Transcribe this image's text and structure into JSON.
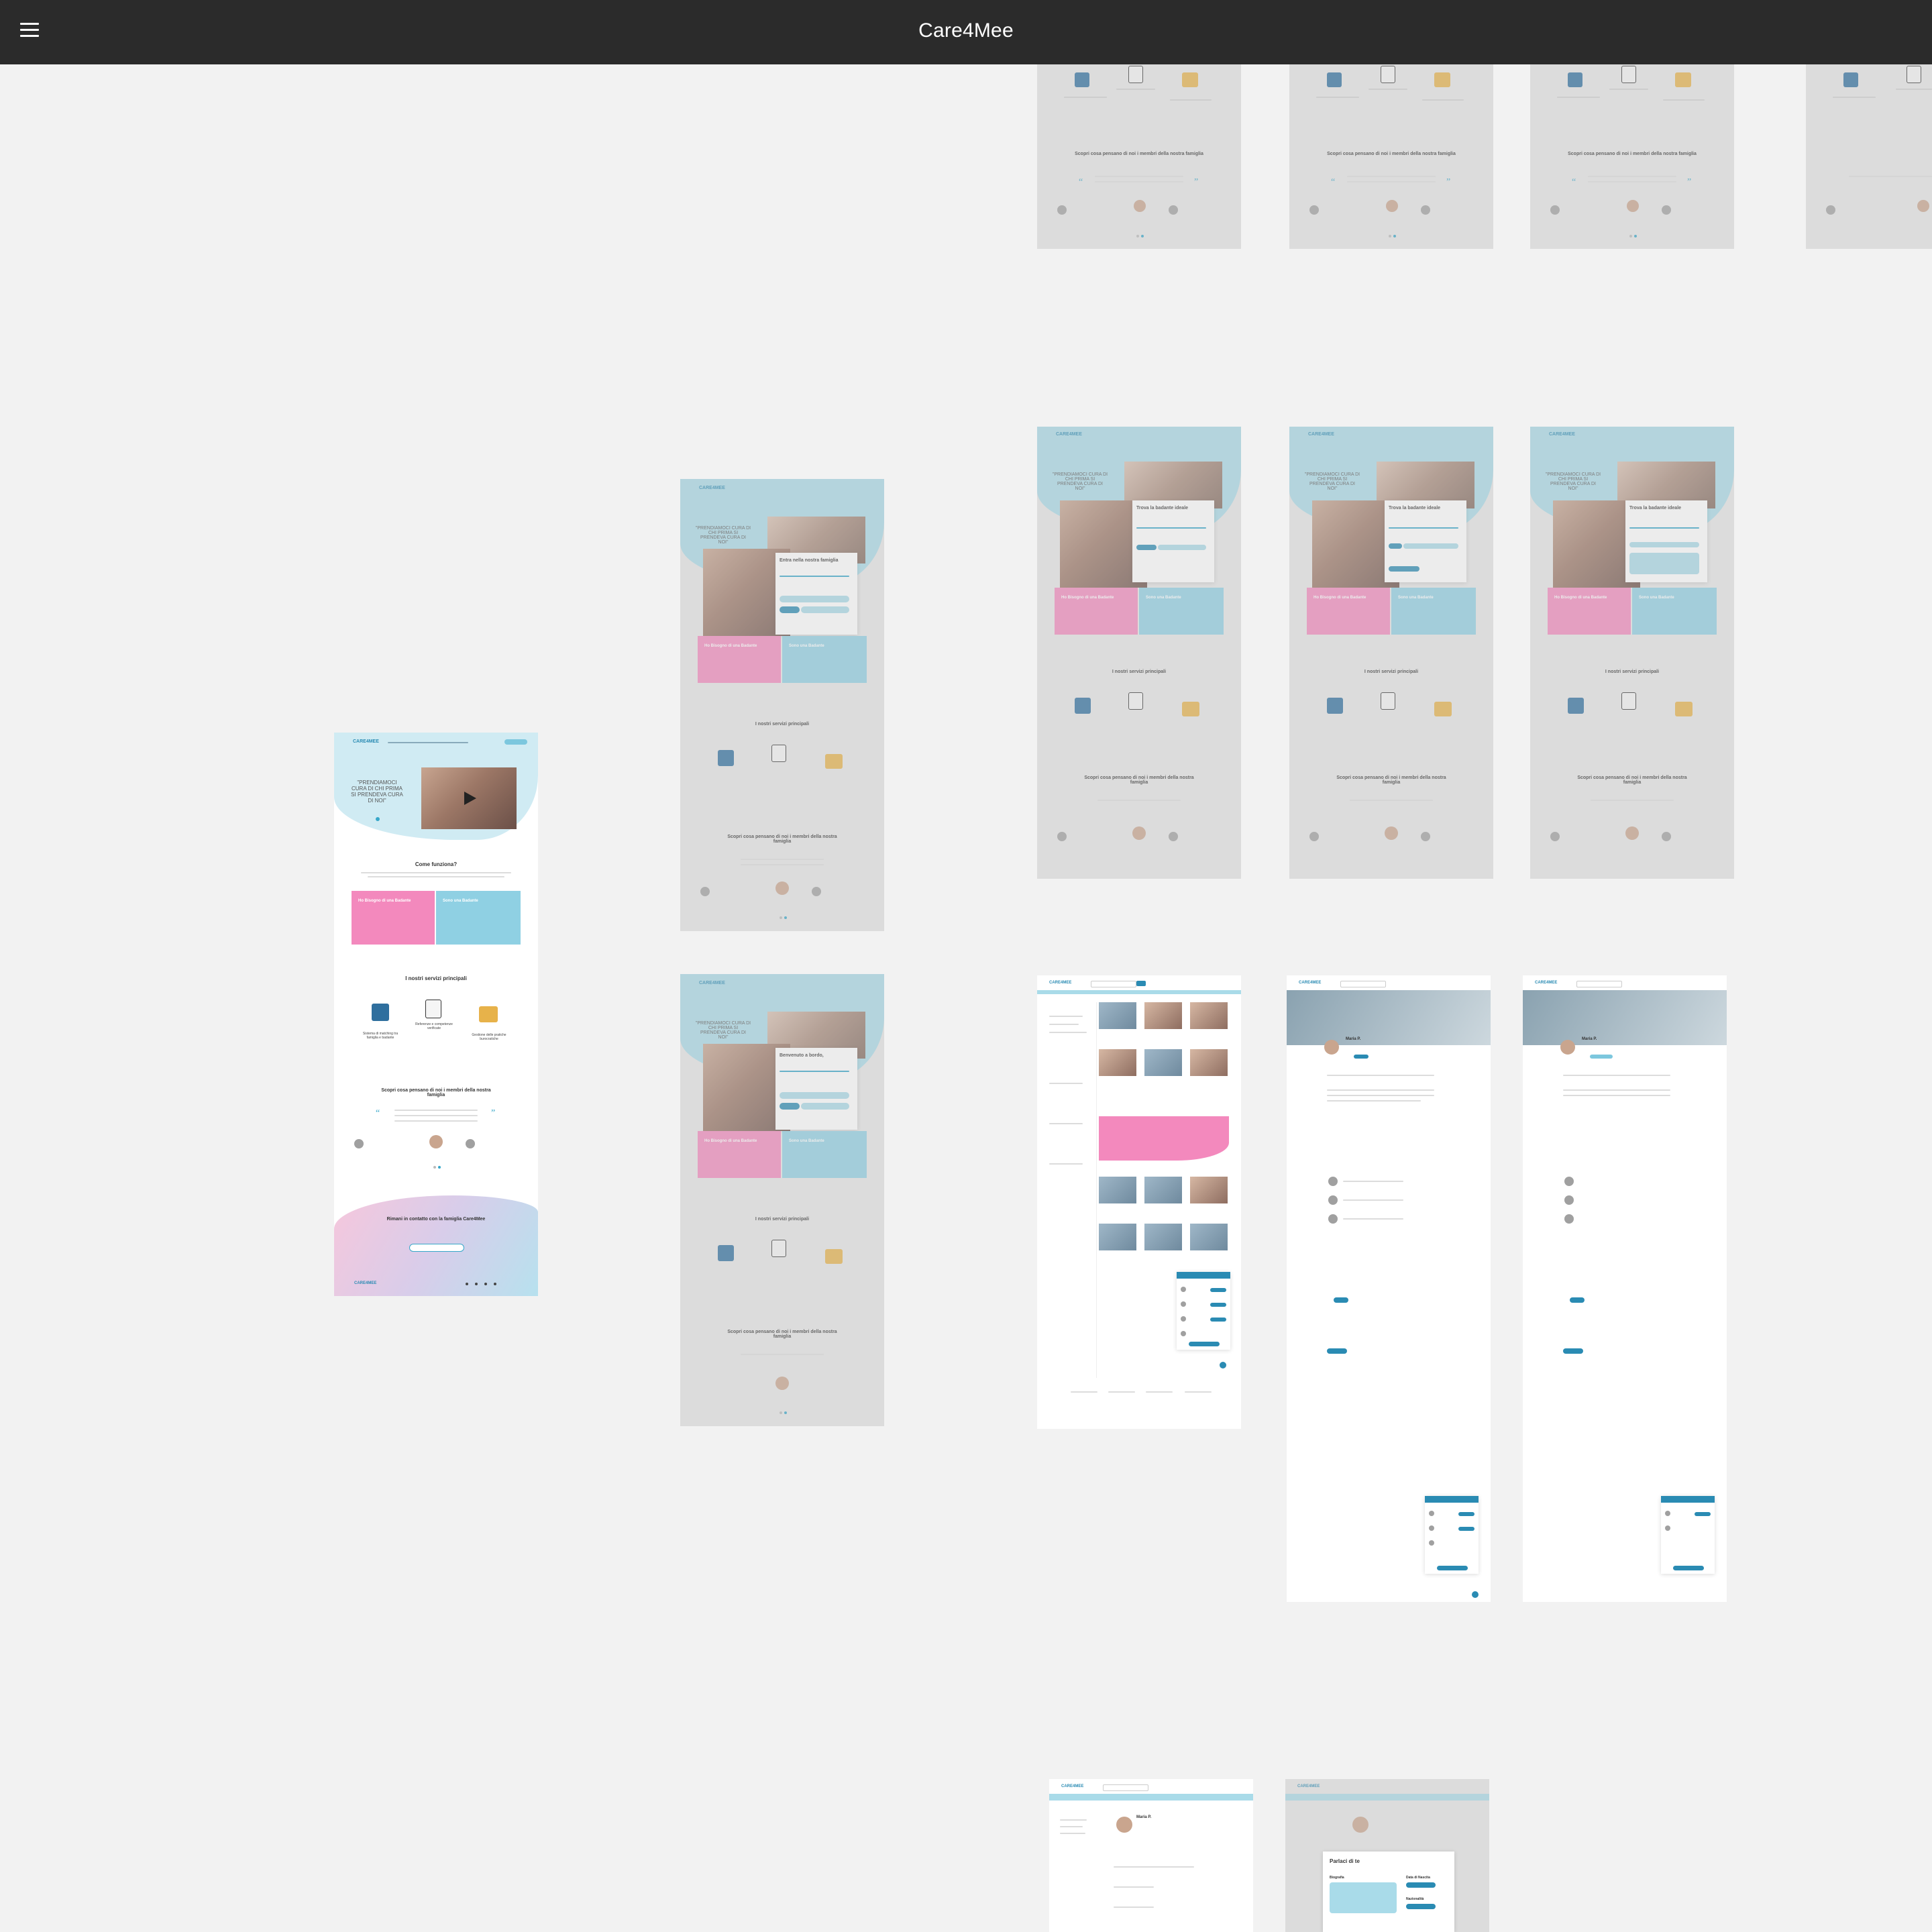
{
  "app": {
    "title": "Care4Mee"
  },
  "brand": {
    "logo_text": "CARE4MEE"
  },
  "hero": {
    "quote": "\"PRENDIAMOCI CURA DI CHI PRIMA SI PRENDEVA CURA DI NOI\""
  },
  "modals": {
    "join_title": "Entra nella nostra famiglia",
    "welcome_title": "Benvenuto a bordo,",
    "find_title": "Trova la badante ideale"
  },
  "sections": {
    "how_it_works": "Come funziona?",
    "services": "I nostri servizi principali",
    "testimonials": "Scopri cosa pensano di noi i membri della nostra famiglia",
    "contact": "Rimani in contatto con la famiglia Care4Mee"
  },
  "cards": {
    "need_carer": "Ho Bisogno di una Badante",
    "am_carer": "Sono una Badante"
  },
  "services": [
    {
      "label": "Sistema di matching tra famiglia e badante",
      "icon": "matching-icon"
    },
    {
      "label": "Referenze e competenze verificate",
      "icon": "checklist-icon"
    },
    {
      "label": "Gestione delle pratiche burocratiche",
      "icon": "paperwork-icon"
    }
  ],
  "profile": {
    "name": "Maria P."
  },
  "personal": {
    "title": "Parlaci di te",
    "bio_label": "Biografia",
    "birth_label": "Data di Nascita",
    "nationality_label": "Nazionalità"
  },
  "colors": {
    "accent": "#37a7c9",
    "pink": "#f389bd",
    "light_blue": "#a9dbe9",
    "topbar": "#2b2b2b",
    "canvas": "#f2f2f2"
  }
}
